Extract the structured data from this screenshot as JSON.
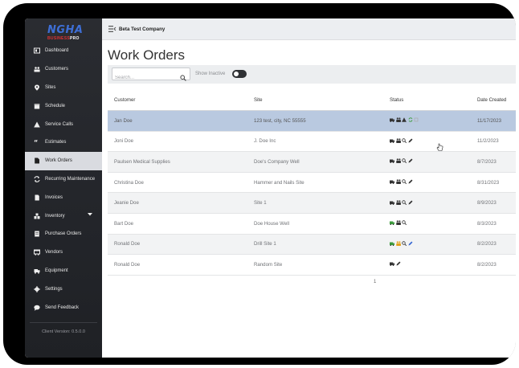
{
  "app": {
    "logo_text": "NGHA",
    "logo_sub_a": "BUSINESS",
    "logo_sub_b": "PRO",
    "company": "Beta Test Company",
    "version": "Client Version: 0.5.0.0"
  },
  "sidebar": {
    "items": [
      {
        "label": "Dashboard",
        "icon": "dashboard-icon"
      },
      {
        "label": "Customers",
        "icon": "customers-icon"
      },
      {
        "label": "Sites",
        "icon": "map-pin-icon"
      },
      {
        "label": "Schedule",
        "icon": "calendar-icon"
      },
      {
        "label": "Service Calls",
        "icon": "warning-icon"
      },
      {
        "label": "Estimates",
        "icon": "quote-icon"
      },
      {
        "label": "Work Orders",
        "icon": "document-icon",
        "active": true
      },
      {
        "label": "Recurring Maintenance",
        "icon": "refresh-icon"
      },
      {
        "label": "Invoices",
        "icon": "invoice-icon"
      },
      {
        "label": "Inventory",
        "icon": "inventory-icon",
        "has_caret": true
      },
      {
        "label": "Purchase Orders",
        "icon": "purchase-order-icon"
      },
      {
        "label": "Vendors",
        "icon": "truck-icon"
      },
      {
        "label": "Equipment",
        "icon": "equipment-icon"
      },
      {
        "label": "Settings",
        "icon": "gear-icon"
      },
      {
        "label": "Send Feedback",
        "icon": "chat-icon"
      }
    ]
  },
  "page": {
    "title": "Work Orders",
    "search_placeholder": "Search...",
    "show_inactive_label": "Show Inactive",
    "show_inactive_on": false
  },
  "table": {
    "headers": {
      "customer": "Customer",
      "site": "Site",
      "status": "Status",
      "date": "Date Created"
    },
    "rows": [
      {
        "customer": "Jan Doe",
        "site": "123 test, city, NC 55555",
        "status": [
          "truck",
          "people",
          "warning",
          "refresh",
          "square"
        ],
        "date": "11/17/2023",
        "selected": true
      },
      {
        "customer": "Joni Doe",
        "site": "J. Doe Inc",
        "status": [
          "truck",
          "people",
          "search",
          "pencil"
        ],
        "date": "11/2/2023"
      },
      {
        "customer": "Paulsen Medical Supplies",
        "site": "Doe's Company Well",
        "status": [
          "truck",
          "people",
          "search",
          "pencil"
        ],
        "date": "8/7/2023"
      },
      {
        "customer": "Christina Doe",
        "site": "Hammer and Nails Site",
        "status": [
          "truck",
          "people",
          "search",
          "pencil"
        ],
        "date": "8/31/2023"
      },
      {
        "customer": "Jeanie Doe",
        "site": "Site 1",
        "status": [
          "truck",
          "people",
          "search",
          "pencil"
        ],
        "date": "8/9/2023"
      },
      {
        "customer": "Bart Doe",
        "site": "Doe House Well",
        "status": [
          "truck-green",
          "people",
          "search"
        ],
        "date": "8/3/2023"
      },
      {
        "customer": "Ronald Doe",
        "site": "Drill Site 1",
        "status": [
          "truck-green",
          "people-orange",
          "search",
          "pencil-blue"
        ],
        "date": "8/2/2023"
      },
      {
        "customer": "Ronald Doe",
        "site": "Random Site",
        "status": [
          "truck",
          "pencil"
        ],
        "date": "8/2/2023"
      }
    ]
  },
  "pagination": {
    "current": "1"
  },
  "colors": {
    "sidebar_bg": "#25272c",
    "active_item": "#d9dbe0",
    "selected_row": "#b9c9e0",
    "brand": "#3e6fd6",
    "green": "#3a9a3a",
    "orange": "#e4a21c",
    "blue": "#3a6ad4"
  }
}
